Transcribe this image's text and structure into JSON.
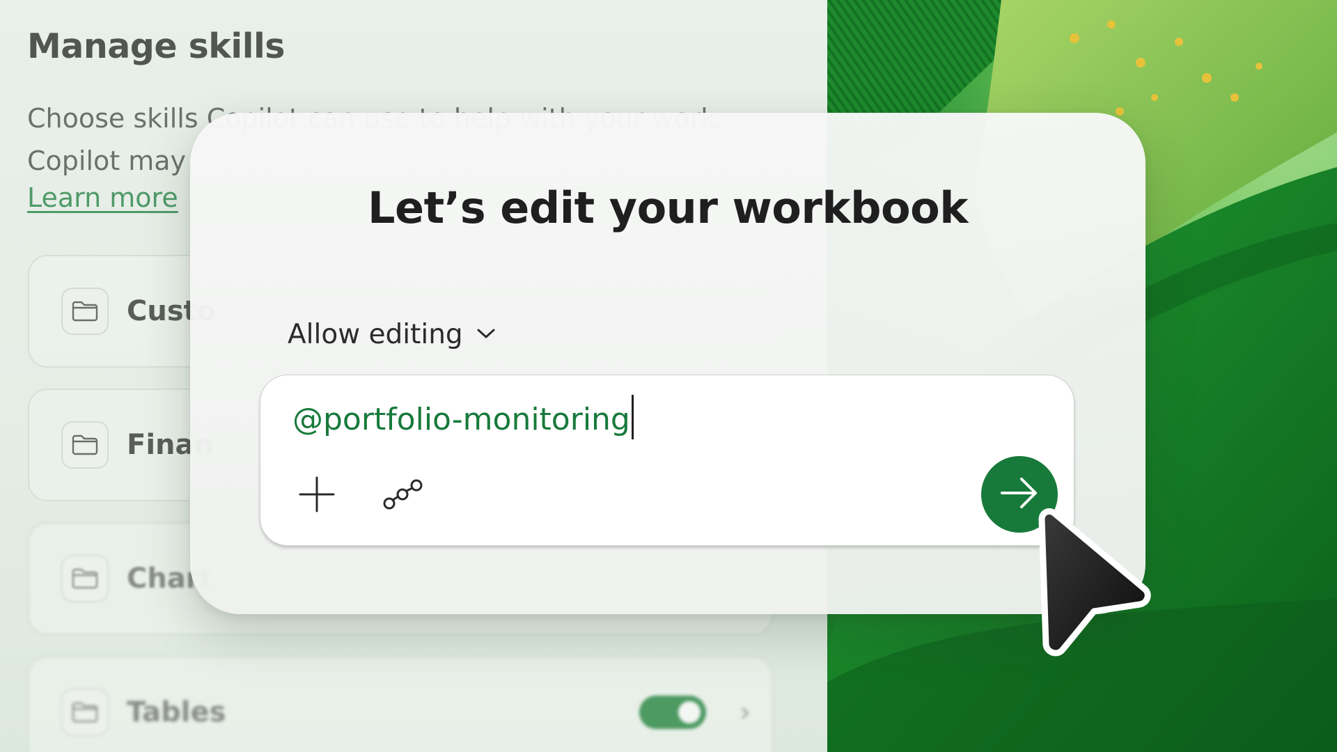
{
  "skills_panel": {
    "title": "Manage skills",
    "description_line1": "Choose skills Copilot can use to help with your work.",
    "description_line2": "Copilot may",
    "learn_more": "Learn more",
    "cards": [
      {
        "label": "Custo"
      },
      {
        "label": "Finan"
      },
      {
        "label": "Chart"
      },
      {
        "label": "Tables",
        "toggle_on": true
      }
    ]
  },
  "dialog": {
    "title": "Let’s edit your workbook",
    "mode_label": "Allow editing",
    "input_value": "@portfolio-monitoring"
  },
  "colors": {
    "accent": "#177a3a",
    "mention_text": "#187a3b",
    "link": "#4f9a69",
    "toggle": "#4d9a62"
  },
  "icons": {
    "mode_dropdown": "chevron-down-icon",
    "add": "plus-icon",
    "skills": "connector-icon",
    "send": "arrow-right-icon",
    "card": "folder-icon",
    "cursor": "mouse-pointer-icon"
  }
}
